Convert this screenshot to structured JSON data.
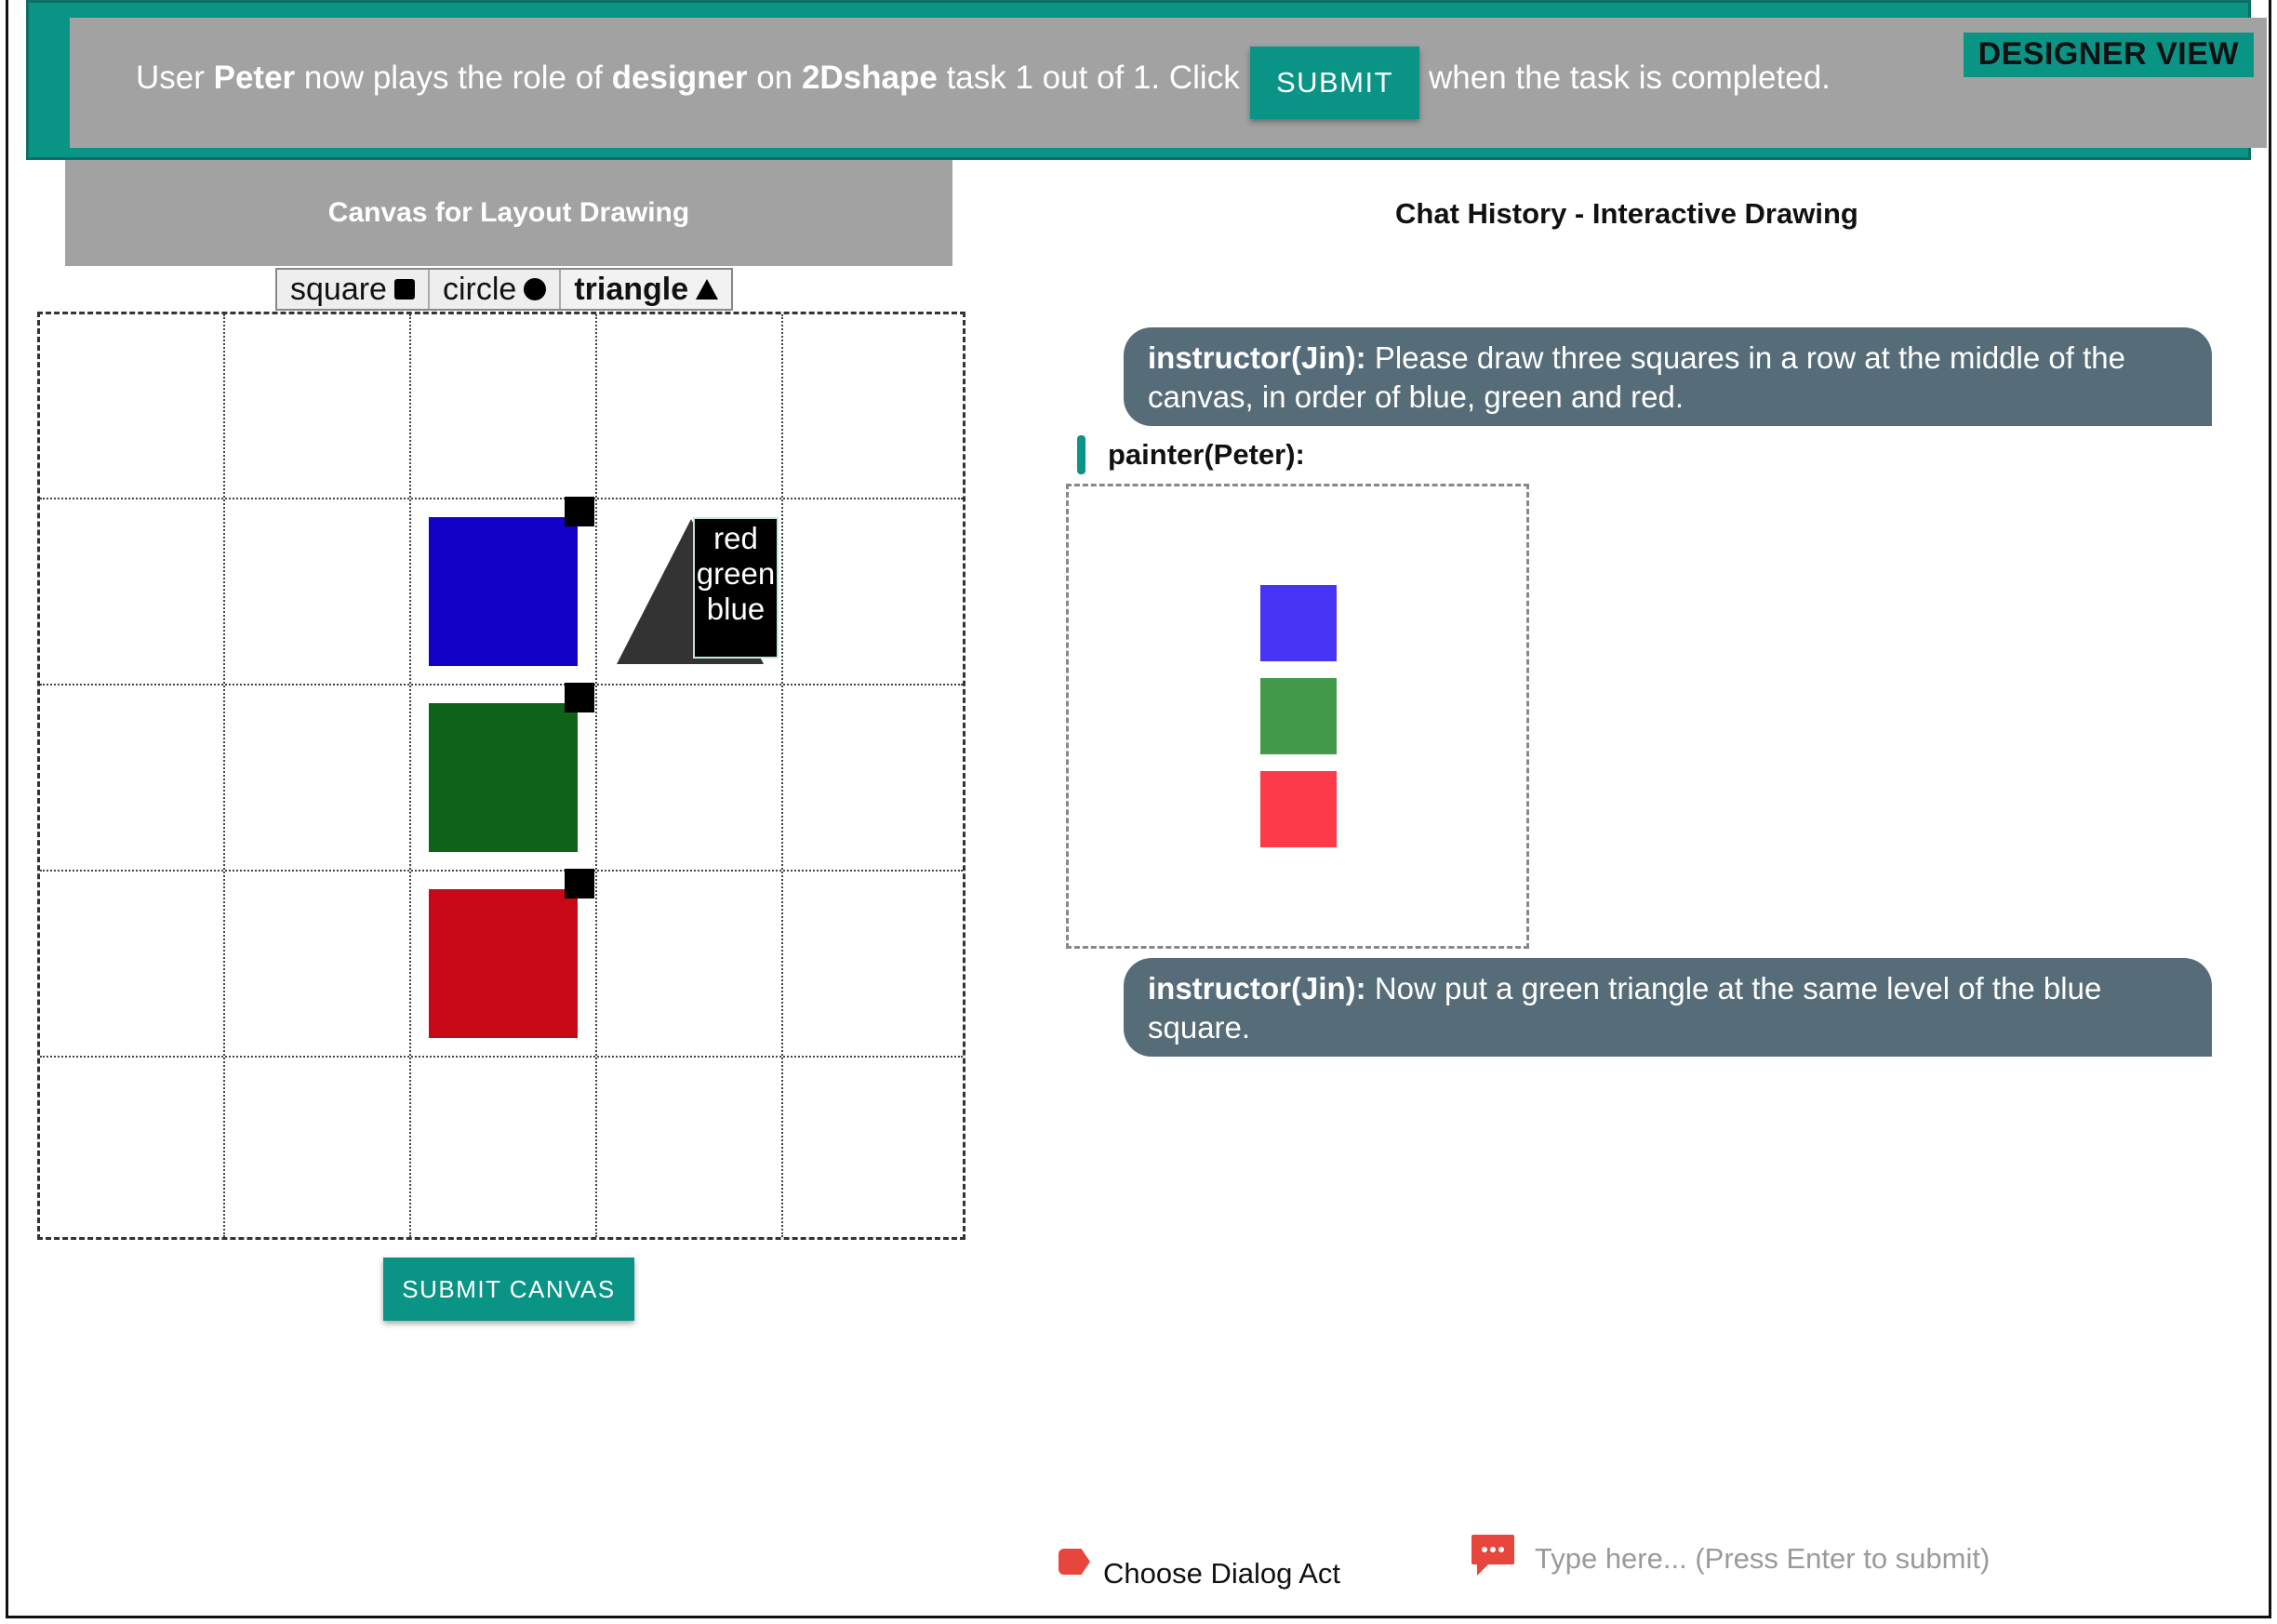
{
  "header": {
    "role_badge": "DESIGNER VIEW",
    "intro_user_prefix": "User ",
    "user": "Peter",
    "intro_mid1": " now plays the role of ",
    "role": "designer",
    "intro_mid2": " on ",
    "task": "2Dshape",
    "intro_suffix": " task 1 out of 1. Click",
    "submit_label": "SUBMIT",
    "trailing_text": "when the task is completed."
  },
  "canvas": {
    "title": "Canvas for Layout Drawing",
    "tools": [
      {
        "label": "square",
        "icon": "square-icon"
      },
      {
        "label": "circle",
        "icon": "circle-icon"
      },
      {
        "label": "triangle",
        "icon": "triangle-icon",
        "active": true
      }
    ],
    "shapes": [
      {
        "type": "square",
        "color": "#1202c8",
        "row": 2,
        "col": 3
      },
      {
        "type": "square",
        "color": "#0f6318",
        "row": 3,
        "col": 3
      },
      {
        "type": "square",
        "color": "#c80717",
        "row": 4,
        "col": 3
      },
      {
        "type": "triangle",
        "color": "#333333",
        "row": 2,
        "col": 4
      }
    ],
    "color_menu": [
      "red",
      "green",
      "blue"
    ],
    "submit_label": "SUBMIT CANVAS"
  },
  "chat": {
    "title": "Chat History - Interactive Drawing",
    "messages": [
      {
        "speaker": "instructor(Jin):",
        "text": " Please draw three squares in a row at the middle of the canvas, in order of blue, green and red."
      },
      {
        "speaker": "painter(Peter):",
        "snapshot_colors": [
          "#4834f4",
          "#429a4a",
          "#fc3a4a"
        ]
      },
      {
        "speaker": "instructor(Jin):",
        "text": " Now put a green triangle at the same level of the blue square."
      }
    ],
    "dialog_act_label": "Choose Dialog Act",
    "input_placeholder": "Type here... (Press Enter to submit)"
  },
  "colors": {
    "accent": "#0a9486",
    "banner_gray": "#a2a2a2",
    "bubble": "#566d79"
  }
}
